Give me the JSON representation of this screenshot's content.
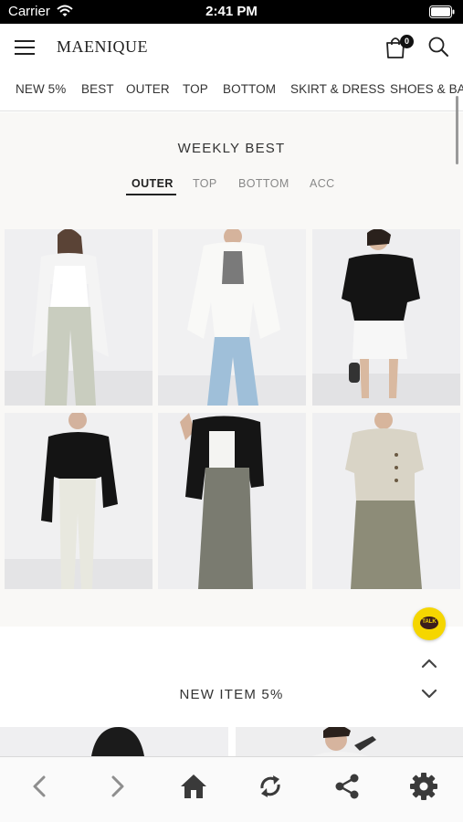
{
  "status_bar": {
    "carrier": "Carrier",
    "time": "2:41 PM"
  },
  "header": {
    "brand": "MAENIQUE",
    "cart_count": "0"
  },
  "categories": [
    "NEW 5%",
    "BEST",
    "OUTER",
    "TOP",
    "BOTTOM",
    "SKIRT & DRESS",
    "SHOES & BAG"
  ],
  "weekly_best": {
    "title": "WEEKLY BEST",
    "tabs": [
      "OUTER",
      "TOP",
      "BOTTOM",
      "ACC"
    ],
    "active_tab": "OUTER"
  },
  "talk_button": {
    "label": "TALK"
  },
  "new_item": {
    "title": "NEW ITEM 5%"
  },
  "colors": {
    "accent": "#222222",
    "talk_yellow": "#f5d600",
    "section_bg": "#f9f8f6"
  },
  "icons": {
    "menu": "menu-icon",
    "cart": "cart-icon",
    "search": "search-icon",
    "back": "chevron-left-icon",
    "forward": "chevron-right-icon",
    "home": "home-icon",
    "refresh": "refresh-icon",
    "share": "share-icon",
    "settings": "gear-icon"
  }
}
